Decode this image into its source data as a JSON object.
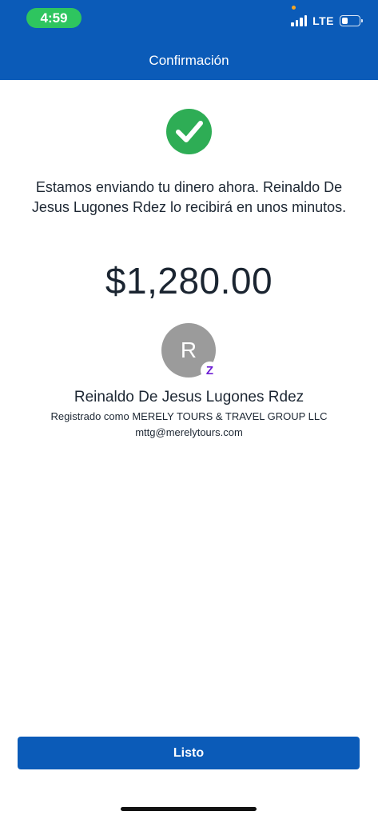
{
  "status_bar": {
    "time": "4:59",
    "network": "LTE",
    "signal_bars": 4,
    "battery_level": 0.35,
    "icons": [
      "signal-icon",
      "battery-icon",
      "privacy-indicator-dot"
    ]
  },
  "header": {
    "title": "Confirmación"
  },
  "confirmation": {
    "icon": "checkmark-icon",
    "message": "Estamos enviando tu dinero ahora. Reinaldo De Jesus Lugones Rdez lo recibirá en unos minutos.",
    "amount": "$1,280.00"
  },
  "recipient": {
    "avatar_initial": "R",
    "badge_glyph": "Z",
    "badge_icon": "zelle-icon",
    "name": "Reinaldo De Jesus Lugones Rdez",
    "registered_as": "Registrado como MERELY TOURS & TRAVEL GROUP LLC",
    "email": "mttg@merelytours.com"
  },
  "actions": {
    "done_label": "Listo"
  },
  "colors": {
    "header_bg": "#0b5bb8",
    "success_green": "#2ead55",
    "time_pill_green": "#2ec55f",
    "zelle_purple": "#6d1ed4",
    "avatar_gray": "#9b9b9b"
  }
}
